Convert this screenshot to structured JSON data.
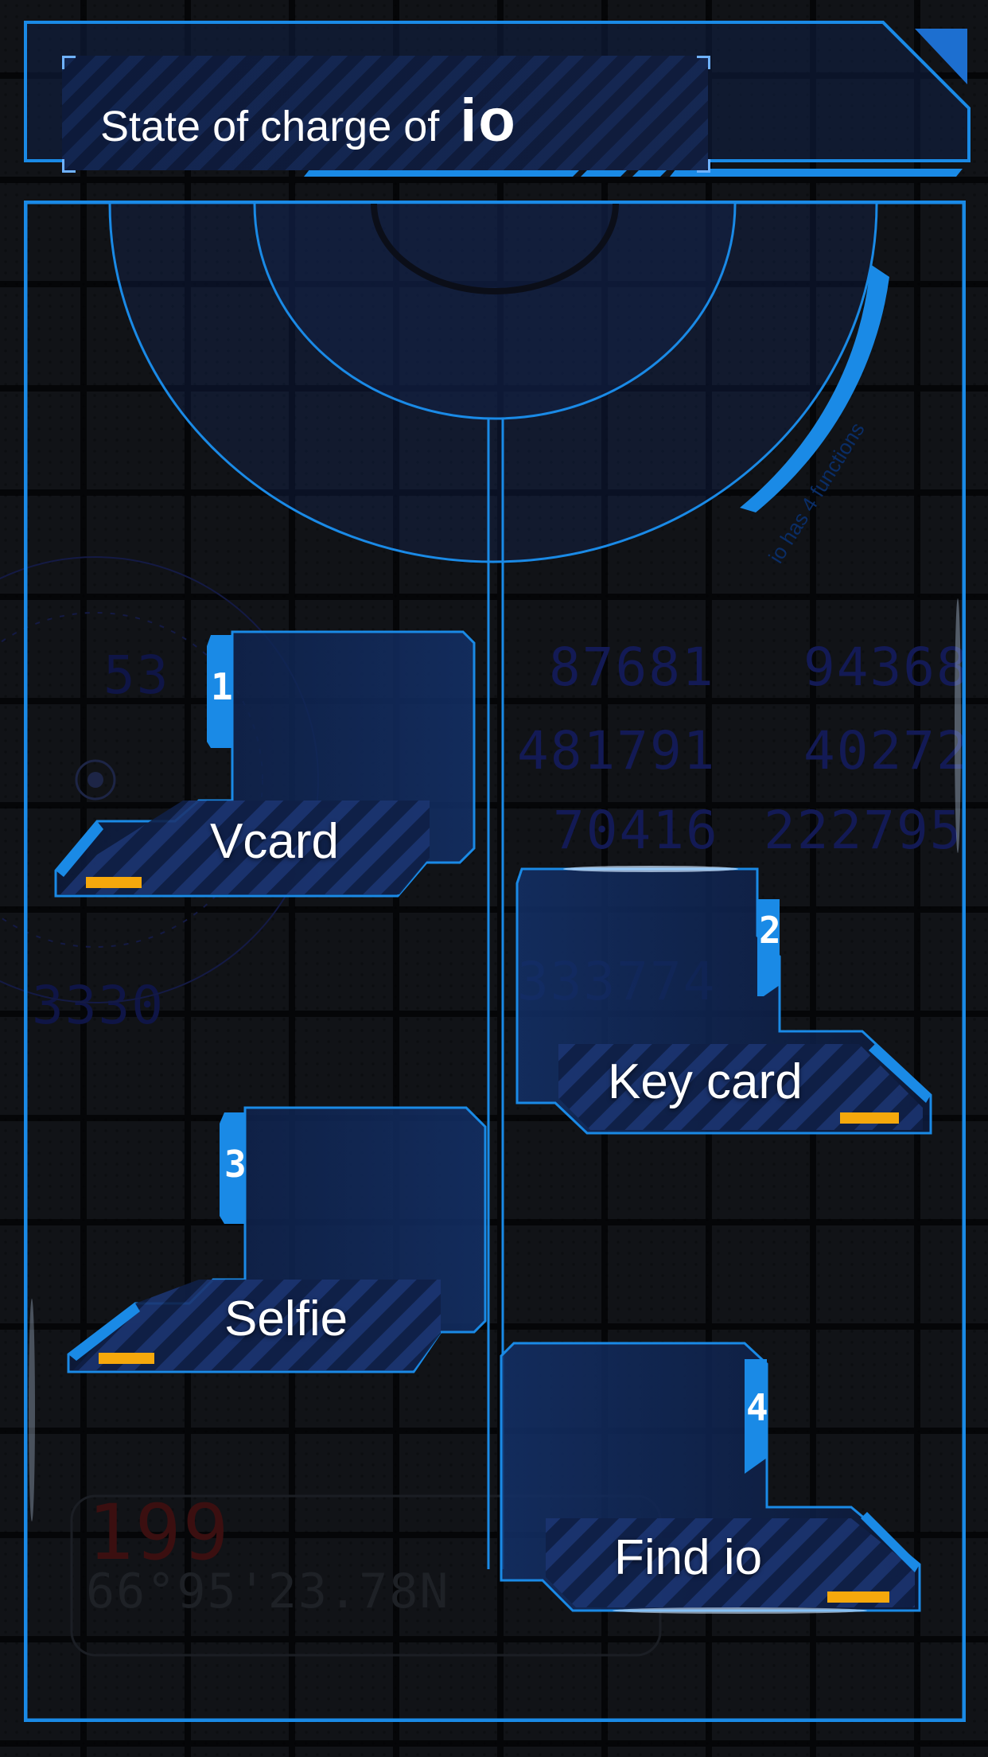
{
  "header": {
    "title": "State of charge of",
    "brand": "io"
  },
  "hub": {
    "caption": "io has 4 functions"
  },
  "functions": [
    {
      "number": "1",
      "label": "Vcard"
    },
    {
      "number": "2",
      "label": "Key card"
    },
    {
      "number": "3",
      "label": "Selfie"
    },
    {
      "number": "4",
      "label": "Find io"
    }
  ],
  "background_numbers": [
    "53",
    "87681",
    "94368",
    "481791",
    "40272",
    "70416",
    "222795",
    "333774",
    "3330",
    "199",
    "66°95'23.78N"
  ],
  "colors": {
    "accent_blue": "#1a8ae6",
    "panel_dark": "#0e1c3e",
    "indicator_orange": "#f5a80c"
  }
}
